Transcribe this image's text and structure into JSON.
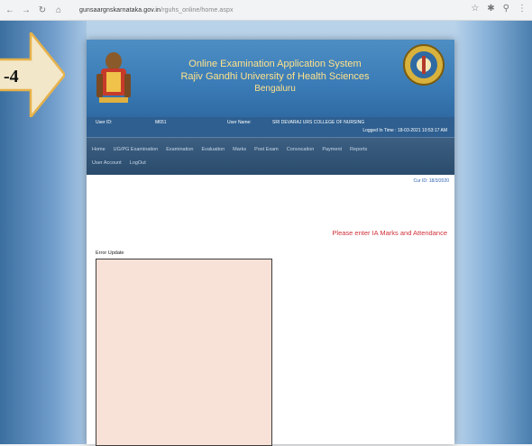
{
  "browser": {
    "url_domain": "gunsaargnskarnataka.gov.in",
    "url_path": "/rguhs_online/home.aspx",
    "icons": [
      "back-icon",
      "forward-icon",
      "reload-icon",
      "home-icon",
      "star-icon",
      "extensions-icon",
      "profile-icon",
      "menu-icon"
    ]
  },
  "callout": {
    "number": "-4"
  },
  "header": {
    "line1": "Online Examination Application System",
    "line2": "Rajiv Gandhi University of Health Sciences",
    "line3": "Bengaluru"
  },
  "info": {
    "user_id_label": "User ID:",
    "user_id_value": "M651",
    "user_name_label": "User Name:",
    "user_name_value": "SRI DEVARAJ URS COLLEGE OF NURSING",
    "logged_in": "Logged In Time : 18-03-2021 10:53:17 AM"
  },
  "menu": {
    "row1": [
      "Home",
      "UG/PG Examination",
      "Examination",
      "Evaluation",
      "Marks",
      "Post Exam",
      "Convocation",
      "Payment",
      "Reports"
    ],
    "row2": [
      "User Account",
      "LogOut"
    ]
  },
  "content": {
    "cur_id": "Cur ID: 18/3/2020",
    "message": "Please enter IA Marks and Attendance",
    "error_label": "Error Update"
  },
  "colors": {
    "header_blue": "#3a7bb6",
    "title_gold": "#ffe28a",
    "message_red": "#d0303a",
    "error_box_bg": "#f8e1d6"
  }
}
